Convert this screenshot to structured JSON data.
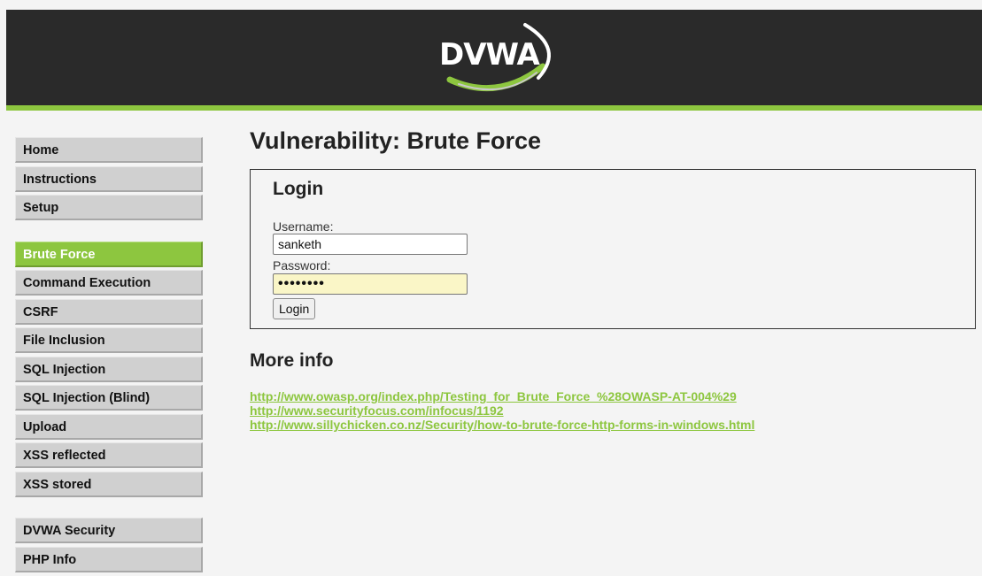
{
  "header": {
    "logo_text": "DVWA",
    "accent_color": "#8dc63f",
    "background_color": "#2a2a2a"
  },
  "menu": {
    "group1": [
      {
        "label": "Home"
      },
      {
        "label": "Instructions"
      },
      {
        "label": "Setup"
      }
    ],
    "group2": [
      {
        "label": "Brute Force",
        "active": true
      },
      {
        "label": "Command Execution"
      },
      {
        "label": "CSRF"
      },
      {
        "label": "File Inclusion"
      },
      {
        "label": "SQL Injection"
      },
      {
        "label": "SQL Injection (Blind)"
      },
      {
        "label": "Upload"
      },
      {
        "label": "XSS reflected"
      },
      {
        "label": "XSS stored"
      }
    ],
    "group3": [
      {
        "label": "DVWA Security"
      },
      {
        "label": "PHP Info"
      }
    ]
  },
  "main": {
    "title": "Vulnerability: Brute Force",
    "login": {
      "heading": "Login",
      "username_label": "Username:",
      "username_value": "sanketh",
      "password_label": "Password:",
      "password_value": "••••••••",
      "button_label": "Login"
    },
    "more_info": {
      "heading": "More info",
      "links": [
        "http://www.owasp.org/index.php/Testing_for_Brute_Force_%28OWASP-AT-004%29",
        "http://www.securityfocus.com/infocus/1192",
        "http://www.sillychicken.co.nz/Security/how-to-brute-force-http-forms-in-windows.html"
      ]
    }
  }
}
